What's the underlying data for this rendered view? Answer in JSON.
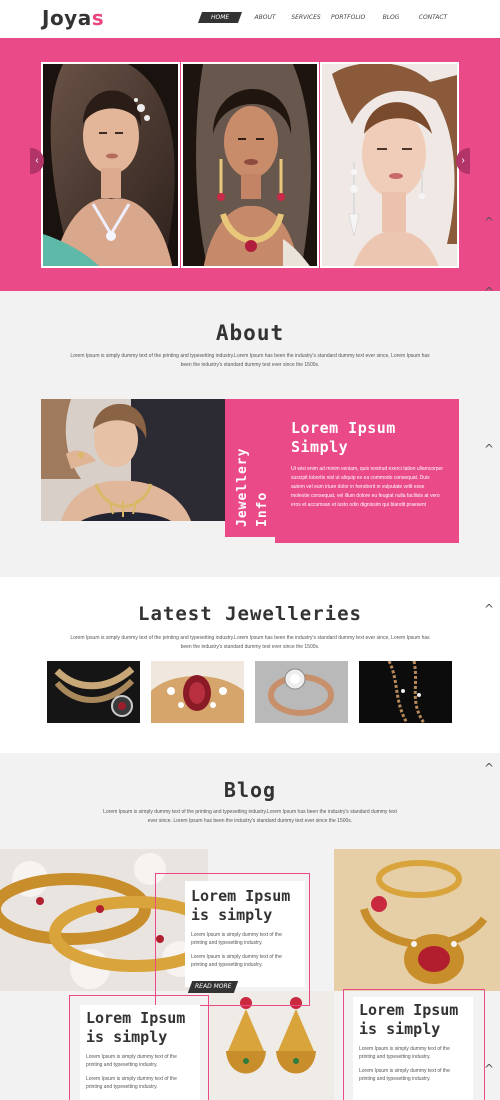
{
  "brand": {
    "name_main": "Joya",
    "name_accent": "s"
  },
  "nav": [
    {
      "label": "HOME"
    },
    {
      "label": "ABOUT"
    },
    {
      "label": "SERVICES"
    },
    {
      "label": "PORTFOLIO"
    },
    {
      "label": "BLOG"
    },
    {
      "label": "CONTACT"
    }
  ],
  "hero": {
    "prev_arrow": "‹",
    "next_arrow": "›"
  },
  "chevron": "^",
  "about": {
    "title": "About",
    "desc": "Lorem Ipsum is simply dummy text of the printing and typesetting industry.Lorem Ipsum has been the industry's standard dummy text ever since, Lorem Ipsum has been the industry's standard dummy text ever since the 1500s.",
    "vertical_label": "Jewellery Info",
    "card_title": "Lorem Ipsum Simply",
    "card_text": "Ut wisi enim ad minim veniam, quis nostrud exerci tation ullamcorper suscipit lobortis nisl ut aliquip ex ea commodo consequat. Duis autem vel eum iriure dolor in hendrerit in vulputate velit esse molestie consequat, vel illum dolore eu feugiat nulla facilisis at vero eros et accumsan et iusto odio dignissim qui blandit praesent"
  },
  "latest": {
    "title": "Latest Jewelleries",
    "desc": "Lorem Ipsum is simply dummy text of the printing and typesetting industry.Lorem Ipsum has been the industry's standard dummy text ever since, Lorem Ipsum has been the industry's standard dummy text ever since the 1500s."
  },
  "blog": {
    "title": "Blog",
    "desc": "Lorem Ipsum is simply dummy text of the printing and typesetting industry.Lorem Ipsum has been the industry's standard dummy text ever since. Lorem Ipsum has been the industry's standard dummy text ever since the 1500s.",
    "post1": {
      "title": "Lorem Ipsum is simply",
      "text1": "Lorem Ipsum is simply dummy text of the printing and typesetting industry.",
      "text2": "Lorem Ipsum is simply dummy text of the printing and typesetting industry.",
      "read_more": "READ MORE"
    },
    "post2": {
      "title": "Lorem Ipsum is simply",
      "text1": "Lorem Ipsum is simply dummy text of the printing and typesetting industry.",
      "text2": "Lorem Ipsum is simply dummy text of the printing and typesetting industry."
    },
    "post3": {
      "title": "Lorem Ipsum is simply",
      "text1": "Lorem Ipsum is simply dummy text of the printing and typesetting industry.",
      "text2": "Lorem Ipsum is simply dummy text of the printing and typesetting industry."
    }
  }
}
